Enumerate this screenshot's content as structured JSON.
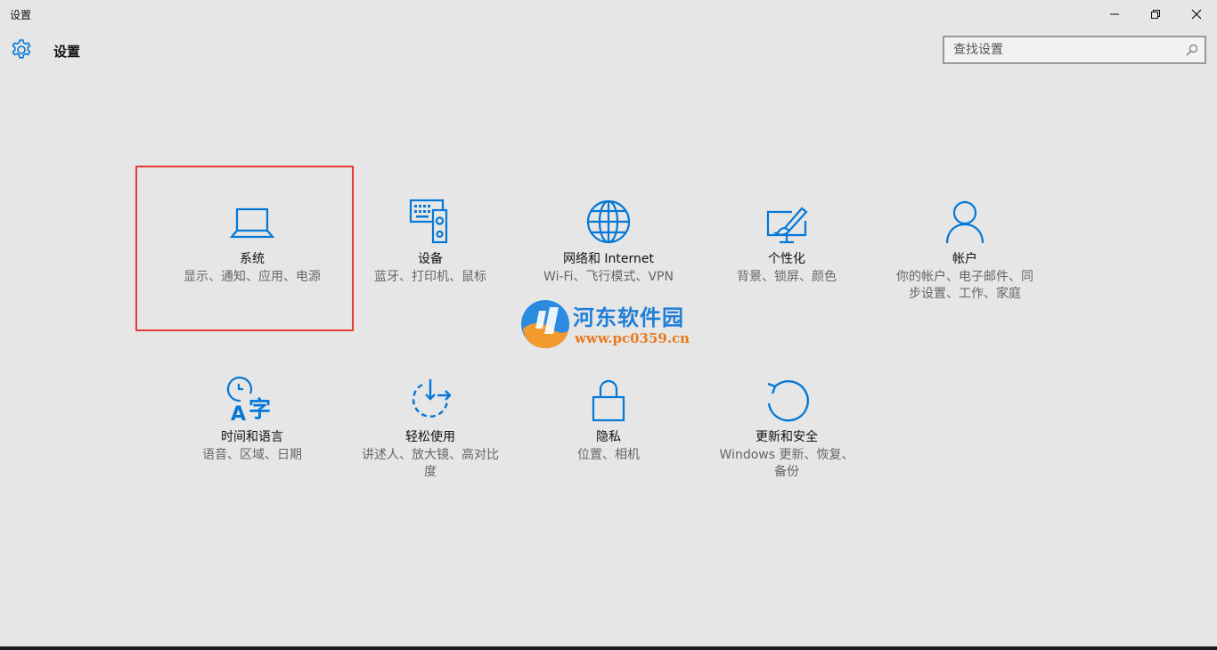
{
  "window": {
    "title": "设置",
    "controls": [
      "minimize-icon",
      "restore-icon",
      "close-icon"
    ]
  },
  "header": {
    "icon": "gear-icon",
    "title": "设置"
  },
  "search": {
    "placeholder": "查找设置",
    "value": "",
    "icon": "search-icon"
  },
  "colors": {
    "accent": "#0078d7",
    "background": "#e6e6e6",
    "highlight_border": "#e53935"
  },
  "tiles": [
    {
      "icon": "laptop-icon",
      "name": "系统",
      "desc": "显示、通知、应用、电源"
    },
    {
      "icon": "devices-icon",
      "name": "设备",
      "desc": "蓝牙、打印机、鼠标"
    },
    {
      "icon": "globe-icon",
      "name": "网络和 Internet",
      "desc": "Wi-Fi、飞行模式、VPN"
    },
    {
      "icon": "personalize-icon",
      "name": "个性化",
      "desc": "背景、锁屏、颜色"
    },
    {
      "icon": "account-icon",
      "name": "帐户",
      "desc": "你的帐户、电子邮件、同步设置、工作、家庭"
    },
    {
      "icon": "time-language-icon",
      "name": "时间和语言",
      "desc": "语音、区域、日期"
    },
    {
      "icon": "ease-of-access-icon",
      "name": "轻松使用",
      "desc": "讲述人、放大镜、高对比度"
    },
    {
      "icon": "lock-icon",
      "name": "隐私",
      "desc": "位置、相机"
    },
    {
      "icon": "update-icon",
      "name": "更新和安全",
      "desc": "Windows 更新、恢复、备份"
    }
  ],
  "watermark": {
    "brand": "河东软件园",
    "url": "www.pc0359.cn"
  }
}
